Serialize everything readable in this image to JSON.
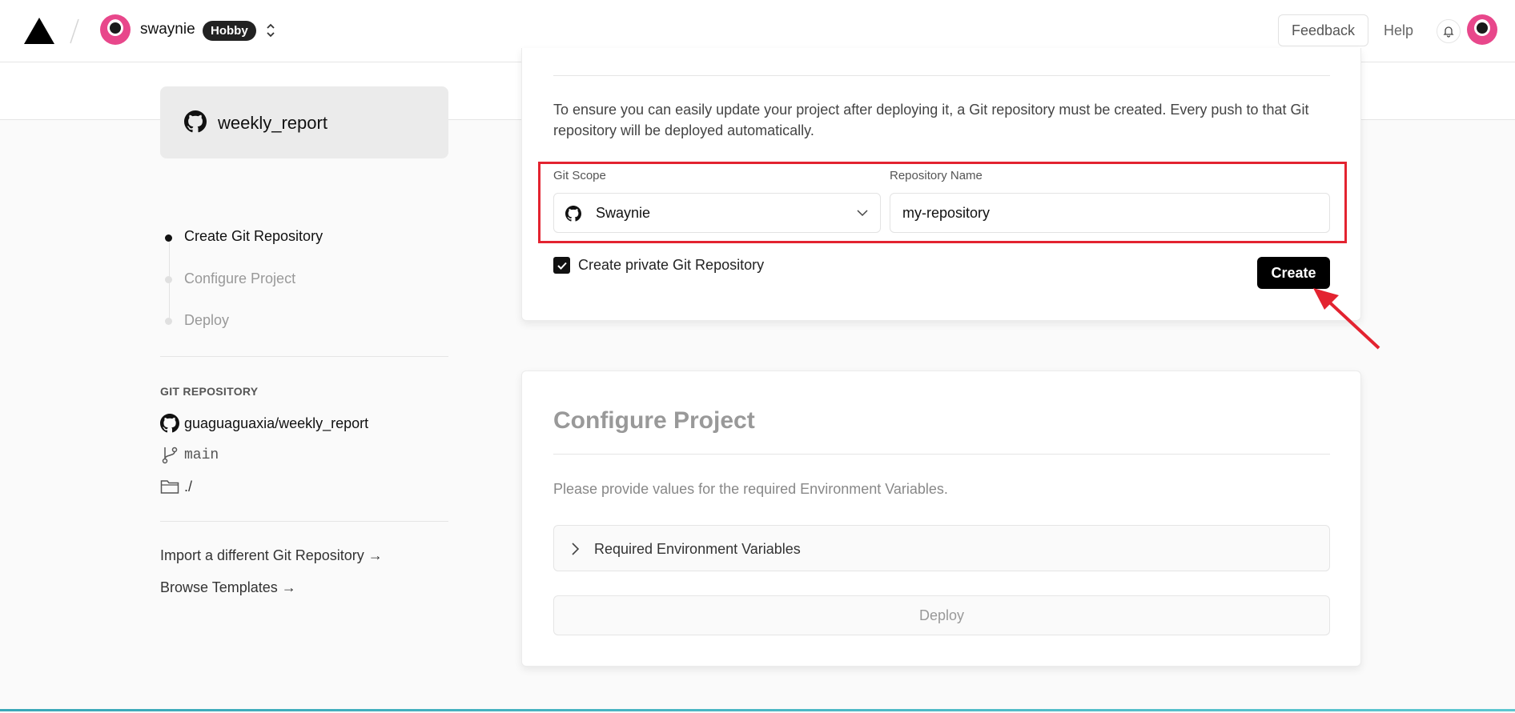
{
  "header": {
    "username": "swaynie",
    "plan": "Hobby",
    "feedback_label": "Feedback",
    "help_label": "Help"
  },
  "sidebar": {
    "repo_name": "weekly_report",
    "steps": [
      {
        "label": "Create Git Repository",
        "active": true
      },
      {
        "label": "Configure Project",
        "active": false
      },
      {
        "label": "Deploy",
        "active": false
      }
    ],
    "git_section_title": "GIT REPOSITORY",
    "git_repo": "guaguaguaxia/weekly_report",
    "branch": "main",
    "root_dir": "./",
    "links": [
      "Import a different Git Repository →",
      "Browse Templates →"
    ]
  },
  "create_repo": {
    "intro": "To ensure you can easily update your project after deploying it, a Git repository must be created. Every push to that Git repository will be deployed automatically.",
    "scope_label": "Git Scope",
    "scope_value": "Swaynie",
    "repo_name_label": "Repository Name",
    "repo_name_value": "my-repository",
    "private_label": "Create private Git Repository",
    "private_checked": true,
    "create_label": "Create"
  },
  "configure": {
    "title": "Configure Project",
    "description": "Please provide values for the required Environment Variables.",
    "env_vars_label": "Required Environment Variables",
    "deploy_label": "Deploy"
  },
  "colors": {
    "highlight": "#e32330",
    "accent": "#000000"
  }
}
